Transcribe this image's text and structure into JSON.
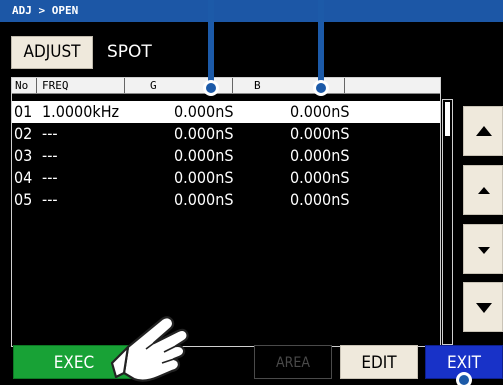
{
  "breadcrumb": "ADJ > OPEN",
  "mode": {
    "button_label": "ADJUST",
    "current": "SPOT"
  },
  "table": {
    "headers": {
      "no": "No",
      "freq": "FREQ",
      "g": "G",
      "b": "B"
    },
    "rows": [
      {
        "no": "01",
        "freq": "1.0000kHz",
        "g": "0.000nS",
        "b": "0.000nS"
      },
      {
        "no": "02",
        "freq": "---",
        "g": "0.000nS",
        "b": "0.000nS"
      },
      {
        "no": "03",
        "freq": "---",
        "g": "0.000nS",
        "b": "0.000nS"
      },
      {
        "no": "04",
        "freq": "---",
        "g": "0.000nS",
        "b": "0.000nS"
      },
      {
        "no": "05",
        "freq": "---",
        "g": "0.000nS",
        "b": "0.000nS"
      }
    ]
  },
  "side_buttons": [
    "page-up-icon",
    "scroll-up-icon",
    "scroll-down-icon",
    "page-down-icon"
  ],
  "bottom": {
    "exec": "EXEC",
    "area": "AREA",
    "edit": "EDIT",
    "exit": "EXIT"
  },
  "colors": {
    "header_bar": "#1c57a6",
    "exec": "#18a236",
    "exit": "#1832c8",
    "callout": "#1c5aa8"
  }
}
